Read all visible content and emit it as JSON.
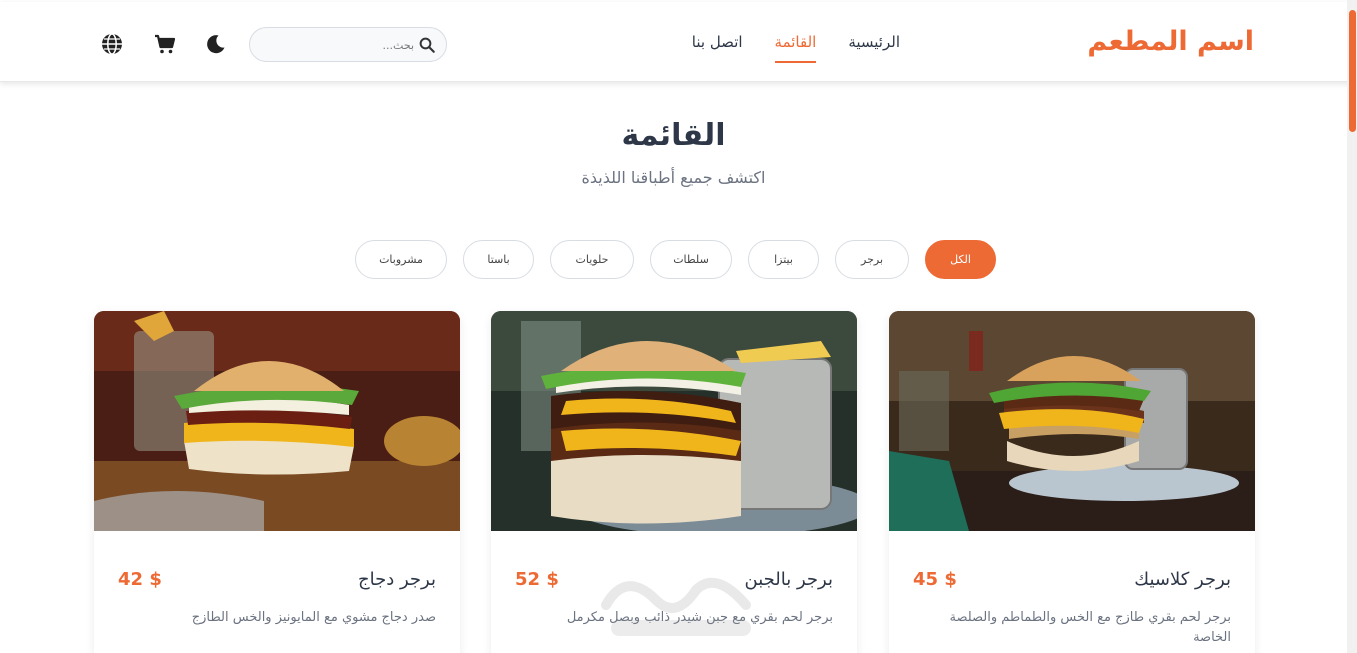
{
  "nav": {
    "brand": "اسم المطعم",
    "links": [
      "الرئيسية",
      "القائمة",
      "اتصل بنا"
    ],
    "active_link": "القائمة",
    "search_placeholder": "بحث...",
    "icons": [
      "search-icon",
      "moon-icon",
      "cart-icon",
      "globe-icon"
    ]
  },
  "header": {
    "title": "القائمة",
    "subtitle": "اكتشف جميع أطباقنا اللذيذة"
  },
  "filters": {
    "items": [
      "الكل",
      "برجر",
      "بيتزا",
      "سلطات",
      "حلويات",
      "باستا",
      "مشروبات"
    ],
    "active": "الكل"
  },
  "cards": [
    {
      "name": "برجر كلاسيك",
      "price": "45 $",
      "description": "برجر لحم بقري طازج مع الخس والطماطم والصلصة الخاصة"
    },
    {
      "name": "برجر بالجبن",
      "price": "52 $",
      "description": "برجر لحم بقري مع جبن شيدر ذائب وبصل مكرمل"
    },
    {
      "name": "برجر دجاج",
      "price": "42 $",
      "description": "صدر دجاج مشوي مع المايونيز والخس الطازج"
    }
  ],
  "watermark": "مستقل mostaql.com",
  "colors": {
    "accent": "#ee6a35",
    "text": "#2d3748",
    "muted": "#6b7280"
  }
}
